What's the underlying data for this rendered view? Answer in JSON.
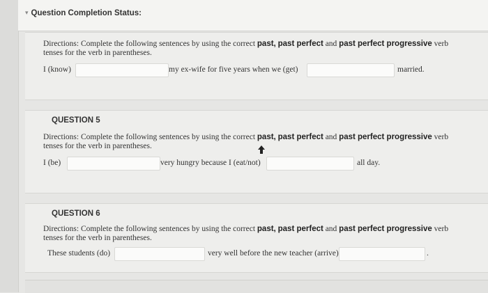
{
  "status": {
    "toggle_icon": "bullet-toggle-icon",
    "label": "Question Completion Status:"
  },
  "questions": [
    {
      "heading": "",
      "directions": {
        "lead": "Directions: Complete the following sentences by using the correct",
        "t1": "past,",
        "t2": "past perfect",
        "and": "and",
        "t3": "past perfect progressive",
        "tail": "verb",
        "line2": "tenses for the verb in parentheses."
      },
      "sentence": {
        "part1": "I (know)",
        "part2": "my ex-wife for five years when we (get)",
        "part3": "married.",
        "blank1": "",
        "blank2": ""
      }
    },
    {
      "heading": "QUESTION 5",
      "directions": {
        "lead": "Directions: Complete the following sentences by using the correct",
        "t1": "past,",
        "t2": "past perfect",
        "and": "and",
        "t3": "past perfect progressive",
        "tail": "verb",
        "line2": "tenses for the verb in parentheses."
      },
      "sentence": {
        "part1": "I (be)",
        "part2": "very hungry because I (eat/not)",
        "part3": "all day.",
        "blank1": "",
        "blank2": ""
      }
    },
    {
      "heading": "QUESTION 6",
      "directions": {
        "lead": "Directions: Complete the following sentences by using the correct",
        "t1": "past,",
        "t2": "past perfect",
        "and": "and",
        "t3": "past perfect progressive",
        "tail": "verb",
        "line2": "tenses for the verb in parentheses."
      },
      "sentence": {
        "part1": "These students (do)",
        "part2": "very well before the new teacher (arrive)",
        "part3": ".",
        "blank1": "",
        "blank2": ""
      }
    }
  ],
  "icons": {
    "cursor": "mouse-cursor-icon"
  }
}
